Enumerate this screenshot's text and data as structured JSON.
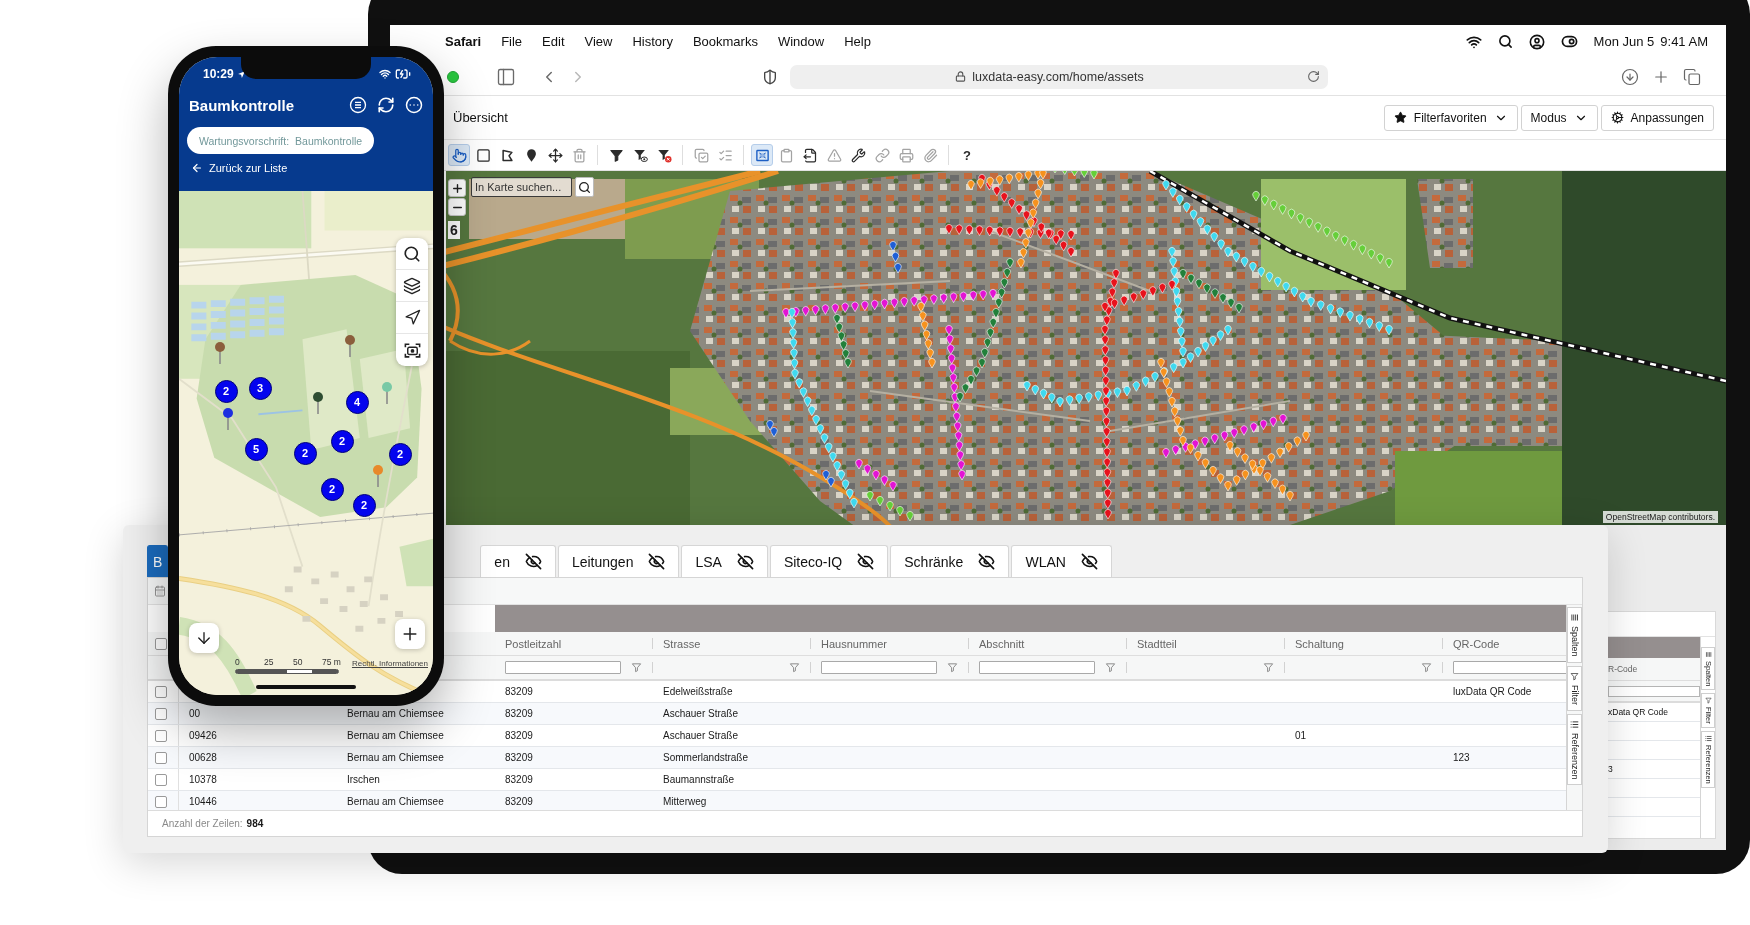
{
  "menu_bar": {
    "app": "Safari",
    "items": [
      "File",
      "Edit",
      "View",
      "History",
      "Bookmarks",
      "Window",
      "Help"
    ],
    "date": "Mon Jun 5",
    "time": "9:41 AM"
  },
  "browser": {
    "url": "luxdata-easy.com/home/assets"
  },
  "app_header": {
    "tab": "Übersicht",
    "buttons": [
      {
        "label": "Filterfavoriten",
        "kind": "favorites"
      },
      {
        "label": "Modus",
        "kind": "dropdown"
      },
      {
        "label": "Anpassungen",
        "kind": "settings"
      }
    ]
  },
  "map_toolbar": {
    "groups": [
      {
        "tools": [
          {
            "selected": true,
            "disabled": false
          },
          {
            "selected": false,
            "disabled": false
          },
          {
            "selected": false,
            "disabled": false
          },
          {
            "selected": false,
            "disabled": false
          },
          {
            "selected": false,
            "disabled": false
          },
          {
            "selected": false,
            "disabled": true
          }
        ]
      },
      {
        "tools": [
          {
            "selected": false,
            "disabled": false
          },
          {
            "selected": false,
            "disabled": false
          },
          {
            "selected": false,
            "disabled": false
          }
        ]
      },
      {
        "tools": [
          {
            "selected": false,
            "disabled": true
          },
          {
            "selected": false,
            "disabled": true
          }
        ]
      },
      {
        "tools": [
          {
            "selected": true,
            "disabled": false
          },
          {
            "selected": false,
            "disabled": true
          },
          {
            "selected": false,
            "disabled": false
          },
          {
            "selected": false,
            "disabled": true
          },
          {
            "selected": false,
            "disabled": false
          },
          {
            "selected": false,
            "disabled": true
          },
          {
            "selected": false,
            "disabled": true
          },
          {
            "selected": false,
            "disabled": true
          }
        ]
      }
    ],
    "help": "?"
  },
  "map": {
    "search_placeholder": "In Karte suchen...",
    "zoom_level": "6",
    "attribution": "OpenStreetMap contributors."
  },
  "background_table": {
    "column": "R-Code",
    "cells": [
      "xData QR Code",
      "",
      "",
      "3"
    ],
    "side_tabs": [
      "Spalten",
      "Filter",
      "Referenzen"
    ]
  },
  "data_panel": {
    "tabs": [
      {
        "label": "B",
        "selected": true,
        "layer_hidden": false
      },
      {
        "label": "en",
        "selected": false,
        "layer_hidden": true
      },
      {
        "label": "Leitungen",
        "selected": false,
        "layer_hidden": true
      },
      {
        "label": "LSA",
        "selected": false,
        "layer_hidden": true
      },
      {
        "label": "Siteco-IQ",
        "selected": false,
        "layer_hidden": true
      },
      {
        "label": "Schränke",
        "selected": false,
        "layer_hidden": true
      },
      {
        "label": "WLAN",
        "selected": false,
        "layer_hidden": true
      }
    ],
    "header_checkbox": {
      "checked": false
    },
    "columns": [
      {
        "kind": "none"
      },
      {
        "kind": "none"
      },
      {
        "label": "Postleitzahl",
        "kind": "input"
      },
      {
        "label": "Strasse",
        "kind": "list"
      },
      {
        "label": "Hausnummer",
        "kind": "input"
      },
      {
        "label": "Abschnitt",
        "kind": "input"
      },
      {
        "label": "Stadtteil",
        "kind": "list"
      },
      {
        "label": "Schaltung",
        "kind": "list"
      },
      {
        "label": "QR-Code",
        "kind": "input"
      }
    ],
    "rows": [
      {
        "checked": false,
        "cells": [
          "",
          "",
          "83209",
          "Edelweißstraße",
          "",
          "",
          "",
          "",
          "luxData QR Code"
        ]
      },
      {
        "checked": false,
        "cells": [
          "00",
          "Bernau am Chiemsee",
          "83209",
          "Aschauer Straße",
          "",
          "",
          "",
          "",
          ""
        ]
      },
      {
        "checked": false,
        "cells": [
          "09426",
          "Bernau am Chiemsee",
          "83209",
          "Aschauer Straße",
          "",
          "",
          "",
          "01",
          ""
        ]
      },
      {
        "checked": false,
        "cells": [
          "00628",
          "Bernau am Chiemsee",
          "83209",
          "Sommerlandstraße",
          "",
          "",
          "",
          "",
          "123"
        ]
      },
      {
        "checked": false,
        "cells": [
          "10378",
          "Irschen",
          "83209",
          "Baumannstraße",
          "",
          "",
          "",
          "",
          ""
        ]
      },
      {
        "checked": false,
        "cells": [
          "10446",
          "Bernau am Chiemsee",
          "83209",
          "Mitterweg",
          "",
          "",
          "",
          "",
          ""
        ]
      }
    ],
    "side_tabs": [
      "Spalten",
      "Filter",
      "Referenzen"
    ],
    "footer": {
      "label": "Anzahl der Zeilen:",
      "value": "984"
    }
  },
  "phone": {
    "time": "10:29",
    "title": "Baumkontrolle",
    "chip": {
      "label": "Wartungsvorschrift:",
      "value": "Baumkontrolle"
    },
    "back_link": "Zurück zur Liste",
    "clusters": [
      "2",
      "3",
      "4",
      "2",
      "2",
      "5",
      "2",
      "2",
      "2"
    ],
    "pins": [
      {
        "color": "#8b5e3c"
      },
      {
        "color": "#8b5e3c"
      },
      {
        "color": "#2e4d32"
      },
      {
        "color": "#78c9a6"
      },
      {
        "color": "#1d2fe0"
      },
      {
        "color": "#e8892a"
      }
    ],
    "scale_labels": [
      "0",
      "25",
      "50",
      "75 m"
    ],
    "legal_link": "Rechtl. Informationen"
  }
}
